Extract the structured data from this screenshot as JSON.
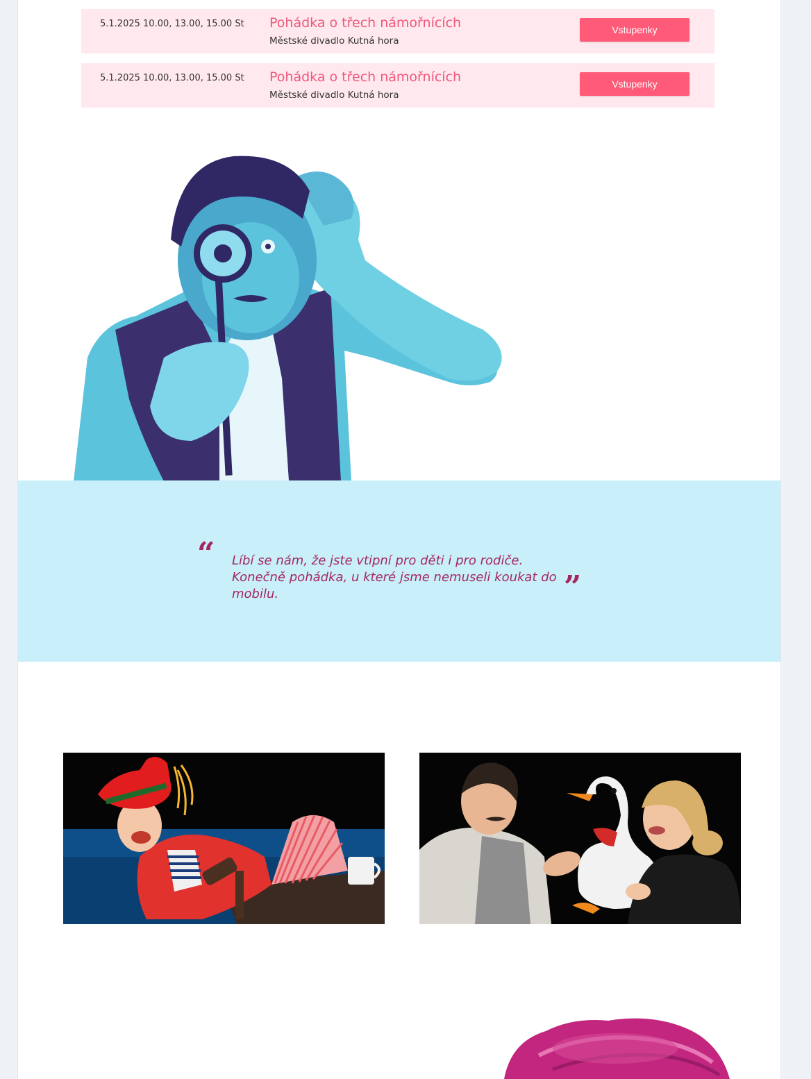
{
  "events": [
    {
      "date": "5.1.2025 10.00, 13.00, 15.00 St",
      "title": "Pohádka o třech námořnících",
      "venue": "Městské divadlo Kutná hora",
      "button": "Vstupenky"
    },
    {
      "date": "5.1.2025 10.00, 13.00, 15.00 St",
      "title": "Pohádka o třech námořnících",
      "venue": "Městské divadlo Kutná hora",
      "button": "Vstupenky"
    }
  ],
  "quote": {
    "open_mark": "“",
    "close_mark": "”",
    "text": "Líbí se nám, že jste vtipní pro děti i pro rodiče. Konečně pohádka, u které jsme nemuseli koukat do mobilu."
  },
  "colors": {
    "accent": "#f0587a",
    "button": "#ff5a78",
    "event_bg": "#ffe9ee",
    "quote_bg": "#c9effb",
    "quote_text": "#a4285f",
    "bottom_art": "#c2267e"
  }
}
